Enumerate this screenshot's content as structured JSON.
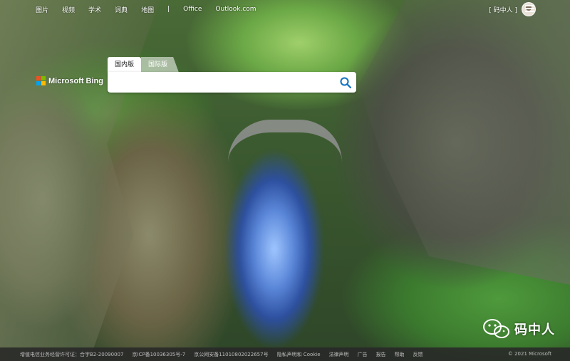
{
  "nav": {
    "links": [
      "图片",
      "视频",
      "学术",
      "词典",
      "地图"
    ],
    "separator": "|",
    "office": "Office",
    "outlook": "Outlook.com"
  },
  "user": {
    "name": "[ 码中人 ]"
  },
  "logo": {
    "text": "Microsoft Bing",
    "colors": [
      "#f25022",
      "#7fba00",
      "#00a4ef",
      "#ffb900"
    ]
  },
  "tabs": {
    "domestic": "国内版",
    "international": "国际版"
  },
  "search": {
    "value": "",
    "placeholder": "",
    "icon": "search-icon",
    "accent": "#0c6fbe"
  },
  "watermark": {
    "text": "码中人",
    "icon": "wechat-icon"
  },
  "footer": {
    "links": [
      "增值电信业务经营许可证：合字B2-20090007",
      "京ICP备10036305号-7",
      "京公网安备11010802022657号",
      "隐私声明和 Cookie",
      "法律声明",
      "广告",
      "报告",
      "帮助",
      "反馈"
    ],
    "copyright": "© 2021 Microsoft"
  }
}
